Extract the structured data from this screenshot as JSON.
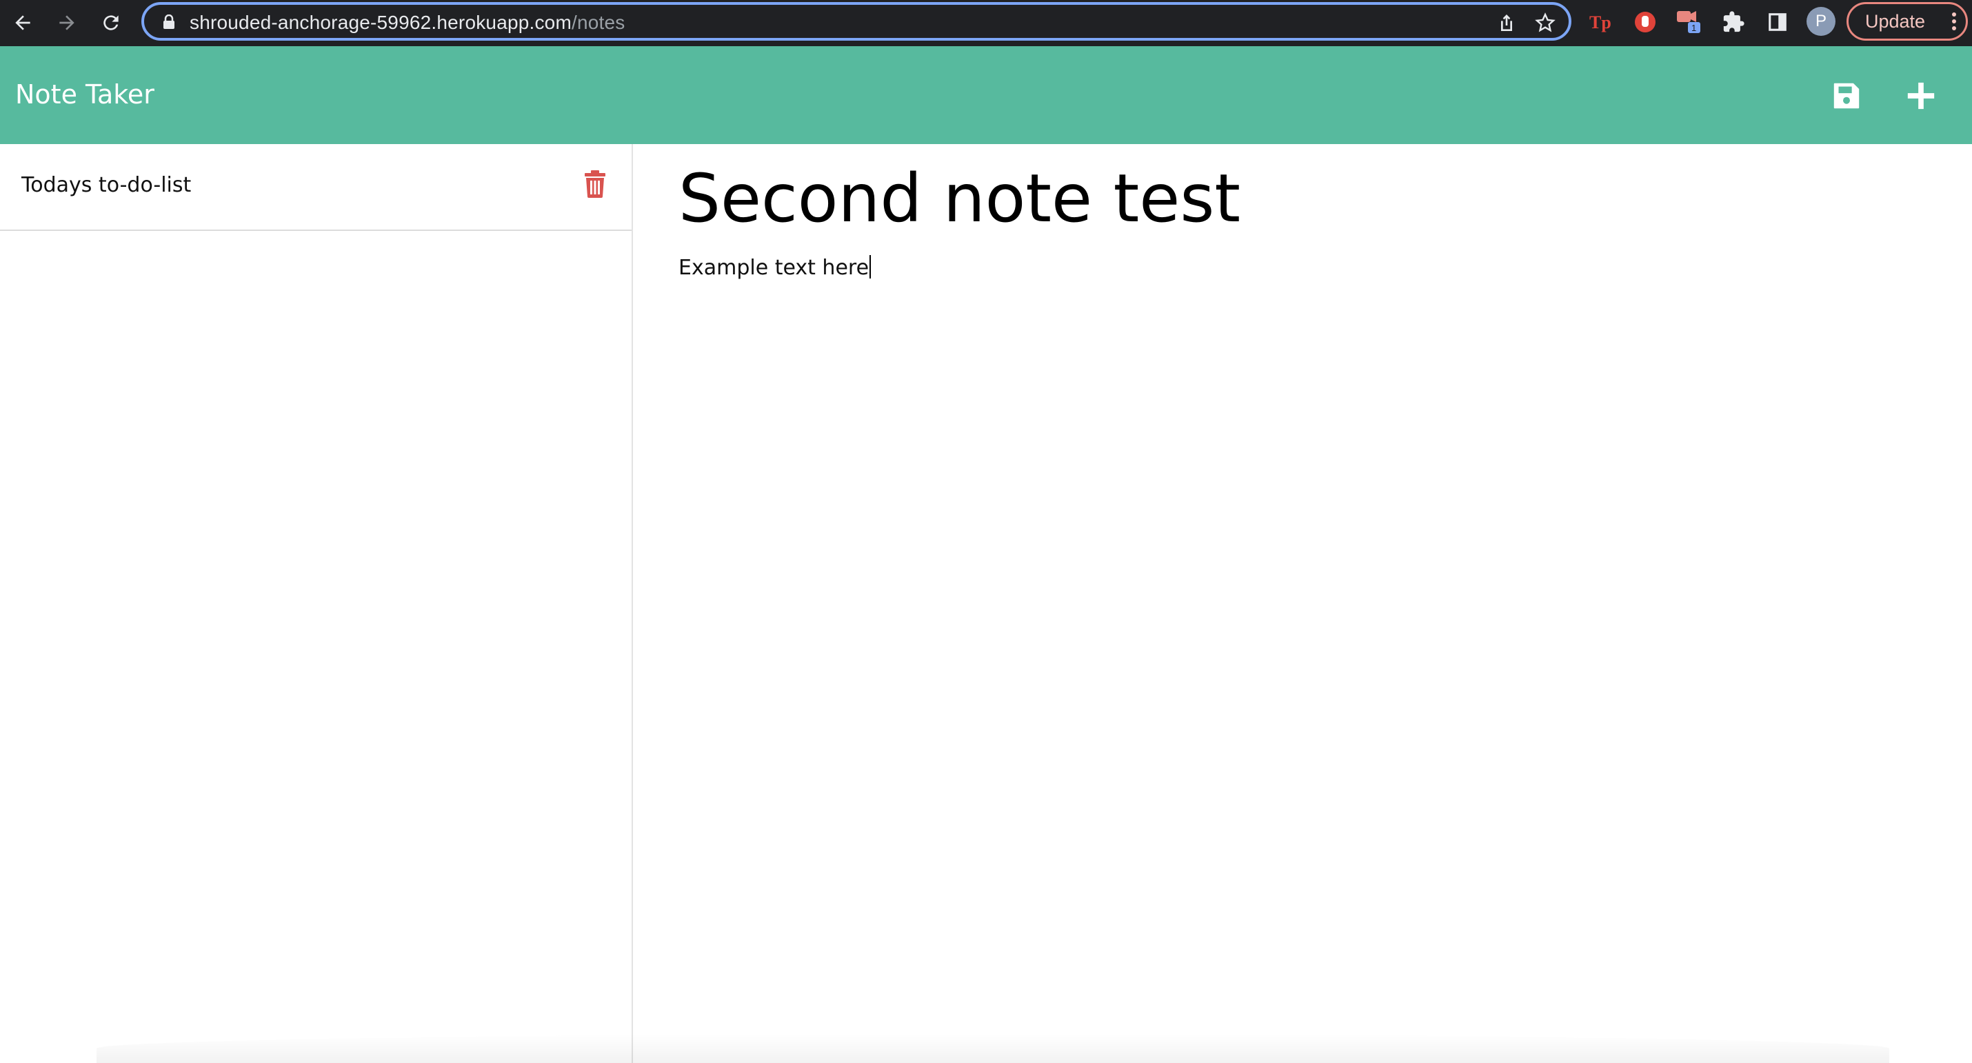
{
  "browser": {
    "url_host": "shrouded-anchorage-59962.herokuapp.com",
    "url_path": "/notes",
    "profile_initial": "P",
    "update_label": "Update",
    "extension_badge": "1",
    "icons": [
      "back-arrow-icon",
      "forward-arrow-icon",
      "reload-icon",
      "lock-icon",
      "share-icon",
      "star-icon",
      "tp-extension-icon",
      "stop-extension-icon",
      "video-extension-icon",
      "puzzle-icon",
      "side-panel-icon",
      "kebab-menu-icon"
    ]
  },
  "app": {
    "title": "Note Taker",
    "header_color": "#57ba9e",
    "actions": [
      "save-icon",
      "plus-icon"
    ]
  },
  "sidebar": {
    "notes": [
      {
        "title": "Todays to-do-list"
      }
    ],
    "delete_icon_color": "#d9534f"
  },
  "editor": {
    "title": "Second note test",
    "body": "Example text here"
  }
}
